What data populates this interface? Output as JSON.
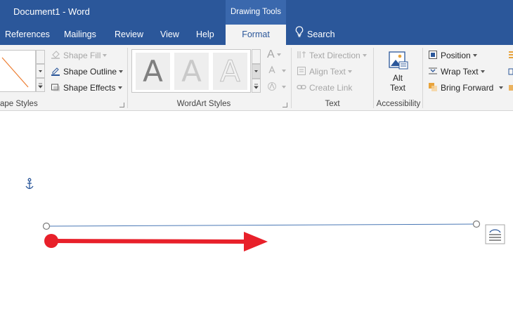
{
  "window": {
    "title": "Document1  -  Word",
    "context_group": "Drawing Tools"
  },
  "tabs": [
    {
      "label": "References"
    },
    {
      "label": "Mailings"
    },
    {
      "label": "Review"
    },
    {
      "label": "View"
    },
    {
      "label": "Help"
    },
    {
      "label": "Format",
      "active": true
    }
  ],
  "search": {
    "label": "Search"
  },
  "ribbon": {
    "shape_styles": {
      "label": "ape Styles",
      "shape_fill": "Shape Fill",
      "shape_outline": "Shape Outline",
      "shape_effects": "Shape Effects"
    },
    "wordart_styles": {
      "label": "WordArt Styles",
      "letters": [
        "A",
        "A",
        "A"
      ],
      "side_letter": "A"
    },
    "text": {
      "label": "Text",
      "text_direction": "Text Direction",
      "align_text": "Align Text",
      "create_link": "Create Link"
    },
    "accessibility": {
      "label": "Accessibility",
      "alt_text_line1": "Alt",
      "alt_text_line2": "Text"
    },
    "arrange": {
      "position": "Position",
      "wrap_text": "Wrap Text",
      "bring_forward": "Bring Forward"
    }
  },
  "colors": {
    "brand_blue": "#2b579a",
    "ribbon_bg": "#f3f3f3",
    "annotation_red": "#e8202a",
    "line_blue": "#4a78b5"
  },
  "icons": [
    "anchor-icon",
    "layout-options-icon",
    "lightbulb-icon"
  ]
}
